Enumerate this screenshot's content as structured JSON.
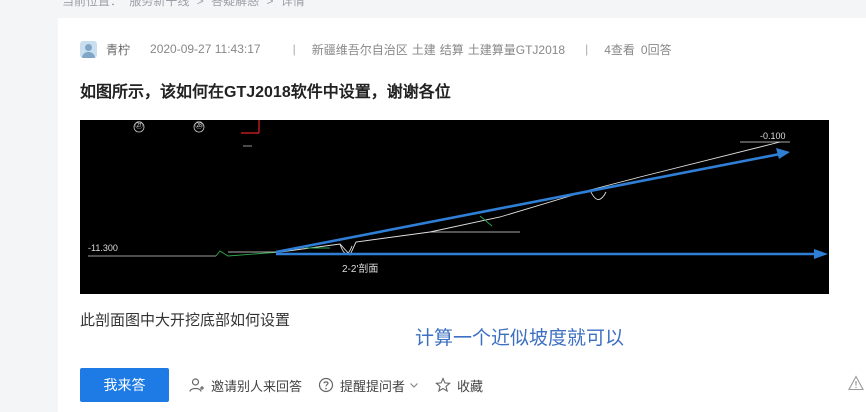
{
  "breadcrumb": [
    "当前位置：",
    "服务新干线",
    ">",
    "答疑解惑",
    ">",
    "详情"
  ],
  "question": {
    "user": "青柠",
    "time": "2020-09-27 11:43:17",
    "separator": "|",
    "region": "新疆维吾尔自治区",
    "tags": [
      "土建",
      "结算",
      "土建算量GTJ2018"
    ],
    "views": "4查看",
    "answers": "0回答",
    "title": "如图所示，该如何在GTJ2018软件中设置，谢谢各位",
    "description": "此剖面图中大开挖底部如何设置"
  },
  "drawing": {
    "grid_label_1": "㉗",
    "grid_label_2": "㉘",
    "elev_left": "-11.300",
    "elev_right": "-0.100",
    "section_label": "2-2'剖面",
    "arrow_color": "#2f7fd6"
  },
  "answer_note": "计算一个近似坡度就可以",
  "actions": {
    "answer_button": "我来答",
    "invite": "邀请别人来回答",
    "remind": "提醒提问者",
    "favorite": "收藏"
  }
}
